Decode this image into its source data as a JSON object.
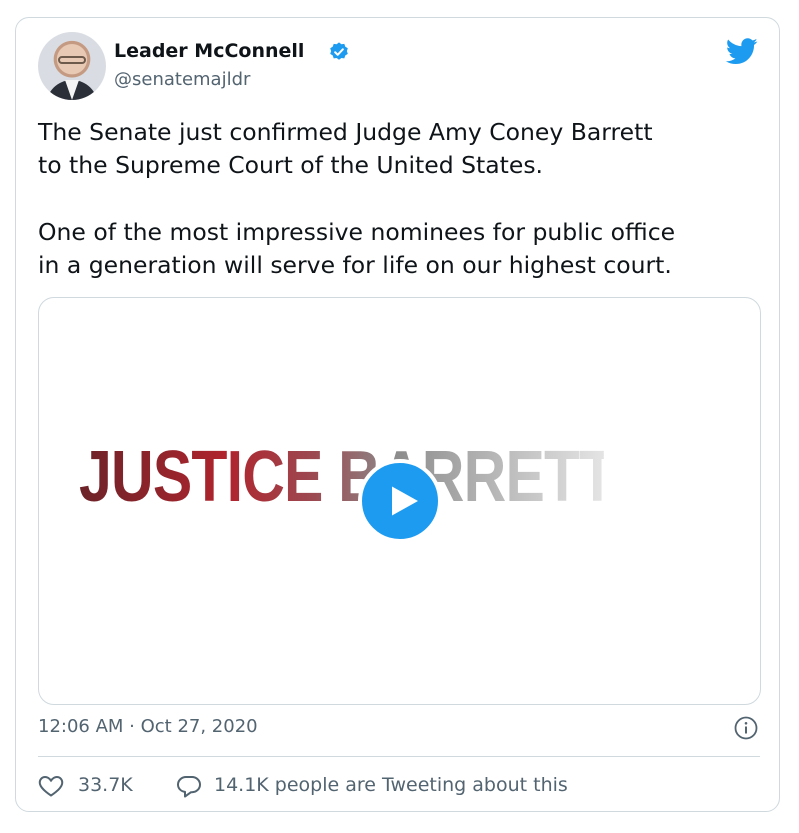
{
  "author": {
    "name": "Leader McConnell",
    "handle": "@senatemajldr",
    "verified": true
  },
  "tweet": {
    "paragraph_1": [
      "The Senate just confirmed Judge Amy Coney Barrett",
      "to the Supreme Court of the United States."
    ],
    "paragraph_2": [
      "One of the most impressive nominees for public office",
      "in a generation will serve for life on our highest court."
    ]
  },
  "media": {
    "headline": "JUSTICE BARRETT",
    "type": "video"
  },
  "timestamp": "12:06 AM · Oct 27, 2020",
  "engagement": {
    "likes": "33.7K",
    "tweeting": "14.1K people are Tweeting about this"
  },
  "colors": {
    "accent": "#1d9bf0",
    "text": "#0f1419",
    "secondary": "#536471",
    "border": "#cfd9de"
  },
  "icons": [
    "verified-badge-icon",
    "twitter-bird-icon",
    "play-icon",
    "info-icon",
    "heart-icon",
    "reply-icon"
  ]
}
